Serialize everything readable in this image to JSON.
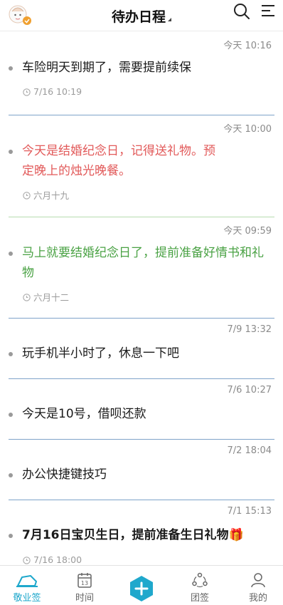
{
  "header": {
    "title": "待办日程",
    "icons": [
      "avatar",
      "search-icon",
      "menu-icon"
    ]
  },
  "todos": [
    {
      "time": "今天 10:16",
      "text": "车险明天到期了，需要提前续保",
      "meta": "7/16 10:19",
      "color": "default"
    },
    {
      "time": "今天 10:00",
      "text": "今天是结婚纪念日，记得送礼物。预定晚上的烛光晚餐。",
      "meta": "六月十九",
      "color": "red"
    },
    {
      "time": "今天 09:59",
      "text": "马上就要结婚纪念日了，提前准备好情书和礼物",
      "meta": "六月十二",
      "color": "green"
    },
    {
      "time": "7/9 13:32",
      "text": "玩手机半小时了，休息一下吧",
      "meta": "",
      "color": "default"
    },
    {
      "time": "7/6 10:27",
      "text": "今天是10号，借呗还款",
      "meta": "",
      "color": "default"
    },
    {
      "time": "7/2 18:04",
      "text": "办公快捷键技巧",
      "meta": "",
      "color": "default"
    },
    {
      "time": "7/1 15:13",
      "text": "7月16日宝贝生日，提前准备生日礼物",
      "meta": "7/16 18:00",
      "color": "default",
      "emoji": "🎁"
    }
  ],
  "tabbar": {
    "items": [
      {
        "label": "敬业签",
        "icon": "cloud-note-icon",
        "active": true
      },
      {
        "label": "时间",
        "icon": "calendar-icon",
        "calendar_day": "13"
      },
      {
        "label": "",
        "icon": "add-icon"
      },
      {
        "label": "团签",
        "icon": "team-icon"
      },
      {
        "label": "我的",
        "icon": "user-icon"
      }
    ]
  },
  "colors": {
    "accent": "#1fa8cc",
    "red_text": "#e25a5a",
    "green_text": "#4aa244",
    "divider": "#7fa3c9"
  }
}
